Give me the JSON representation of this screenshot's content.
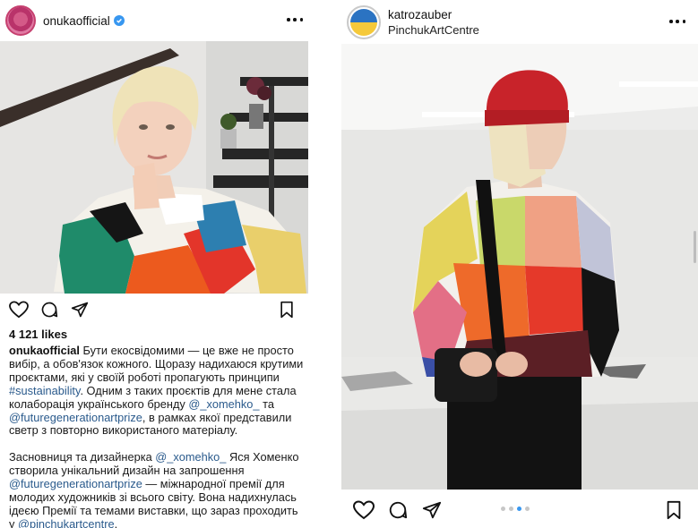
{
  "left_post": {
    "username": "onukaofficial",
    "likes": "4 121 likes",
    "caption": {
      "username": "onukaofficial",
      "p1_a": " Бути екосвідомими — це вже не просто вибір, а обов'язок кожного. Щоразу надихаюся крутими проєктами, які у своїй роботі пропагують принципи ",
      "p1_tag": "#sustainability",
      "p1_b": ". Одним з таких проєктів для мене стала колаборація українського бренду ",
      "p1_mention1": "@_xomehko_",
      "p1_c": " та ",
      "p1_mention2": "@futuregenerationartprize",
      "p1_d": ", в рамках якої представили светр з повторно використаного матеріалу.",
      "p2_a": "Засновниця та дизайнерка ",
      "p2_mention1": "@_xomehko_",
      "p2_b": " Яся Хоменко створила унікальний дизайн на запрошення ",
      "p2_mention2": "@futuregenerationartprize",
      "p2_c": " — міжнародної премії для молодих художників зі всього світу. Вона надихнулась ідеєю Премії та темами виставки, що зараз проходить у ",
      "p2_mention3": "@pinchukartcentre",
      "p2_d": "."
    },
    "icons": [
      "heart-icon",
      "comment-icon",
      "share-icon",
      "bookmark-icon",
      "more-icon",
      "verified-icon"
    ]
  },
  "right_post": {
    "username": "katrozauber",
    "location": "PinchukArtCentre",
    "carousel": {
      "count": 4,
      "active": 3
    },
    "icons": [
      "heart-icon",
      "comment-icon",
      "share-icon",
      "bookmark-icon",
      "more-icon"
    ]
  },
  "colors": {
    "link": "#2a5a8c",
    "verified": "#3897f0",
    "dot_active": "#3897f0",
    "dot_inactive": "#c7c7c7",
    "hat_red": "#c8232a"
  }
}
